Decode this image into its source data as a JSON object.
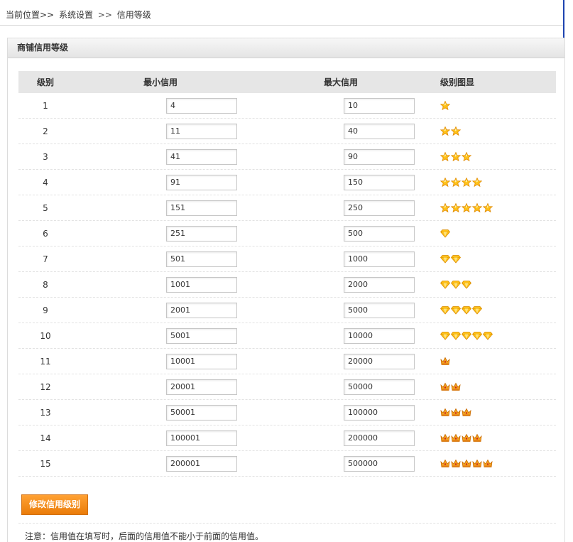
{
  "breadcrumb": {
    "prefix": "当前位置>>",
    "items": [
      "系统设置",
      ">>",
      "信用等级"
    ]
  },
  "panel": {
    "title": "商铺信用等级"
  },
  "table": {
    "headers": [
      "级别",
      "最小信用",
      "最大信用",
      "级别图显"
    ],
    "rows": [
      {
        "level": "1",
        "min": "4",
        "max": "10",
        "icon": "star-icon",
        "count": 1
      },
      {
        "level": "2",
        "min": "11",
        "max": "40",
        "icon": "star-icon",
        "count": 2
      },
      {
        "level": "3",
        "min": "41",
        "max": "90",
        "icon": "star-icon",
        "count": 3
      },
      {
        "level": "4",
        "min": "91",
        "max": "150",
        "icon": "star-icon",
        "count": 4
      },
      {
        "level": "5",
        "min": "151",
        "max": "250",
        "icon": "star-icon",
        "count": 5
      },
      {
        "level": "6",
        "min": "251",
        "max": "500",
        "icon": "diamond-icon",
        "count": 1
      },
      {
        "level": "7",
        "min": "501",
        "max": "1000",
        "icon": "diamond-icon",
        "count": 2
      },
      {
        "level": "8",
        "min": "1001",
        "max": "2000",
        "icon": "diamond-icon",
        "count": 3
      },
      {
        "level": "9",
        "min": "2001",
        "max": "5000",
        "icon": "diamond-icon",
        "count": 4
      },
      {
        "level": "10",
        "min": "5001",
        "max": "10000",
        "icon": "diamond-icon",
        "count": 5
      },
      {
        "level": "11",
        "min": "10001",
        "max": "20000",
        "icon": "crown-icon",
        "count": 1
      },
      {
        "level": "12",
        "min": "20001",
        "max": "50000",
        "icon": "crown-icon",
        "count": 2
      },
      {
        "level": "13",
        "min": "50001",
        "max": "100000",
        "icon": "crown-icon",
        "count": 3
      },
      {
        "level": "14",
        "min": "100001",
        "max": "200000",
        "icon": "crown-icon",
        "count": 4
      },
      {
        "level": "15",
        "min": "200001",
        "max": "500000",
        "icon": "crown-icon",
        "count": 5
      }
    ]
  },
  "submit": {
    "label": "修改信用级别"
  },
  "note": "注意：信用值在填写时，后面的信用值不能小于前面的信用值。",
  "colors": {
    "accent": "#f08a1c",
    "star": "#ffb400",
    "diamond": "#ffc21a",
    "crown": "#f0a020",
    "border_blue": "#1d43b0"
  }
}
